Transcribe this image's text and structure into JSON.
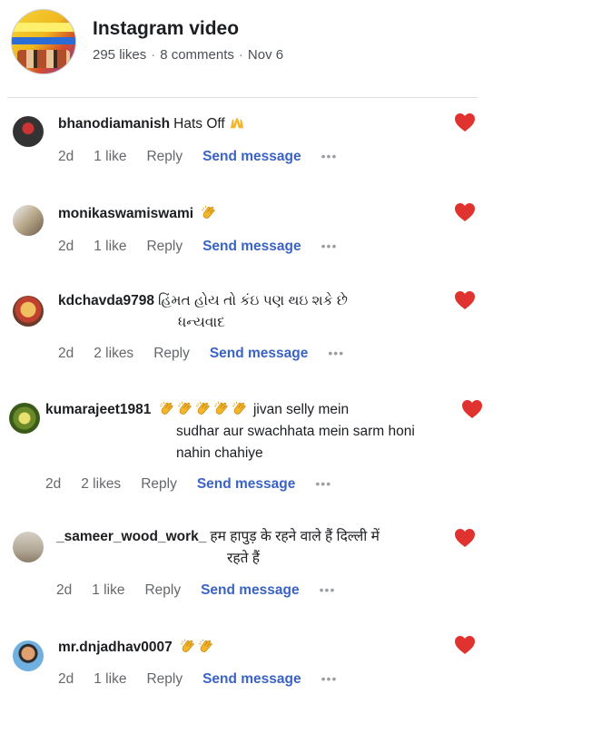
{
  "header": {
    "title": "Instagram video",
    "likes": "295 likes",
    "comments": "8 comments",
    "date": "Nov 6"
  },
  "colors": {
    "heart": "#e0332f",
    "link": "#3b63c4",
    "muted": "#65676b"
  },
  "comments": [
    {
      "user": "bhanodiamanish",
      "text": "Hats Off",
      "emoji": "raised-hands",
      "age": "2d",
      "likes": "1 like",
      "reply": "Reply",
      "send": "Send message",
      "more": "•••"
    },
    {
      "user": "monikaswamiswami",
      "text": "",
      "emoji": "clap",
      "age": "2d",
      "likes": "1 like",
      "reply": "Reply",
      "send": "Send message",
      "more": "•••"
    },
    {
      "user": "kdchavda9798",
      "text": "હિંમત હોય તો કંઇ પણ થઇ શકે છે",
      "text2": "ધન્યવાદ",
      "age": "2d",
      "likes": "2 likes",
      "reply": "Reply",
      "send": "Send message",
      "more": "•••"
    },
    {
      "user": "kumarajeet1981",
      "text": "jivan selly mein",
      "text2": "sudhar aur swachhata mein sarm honi",
      "text3": "nahin chahiye",
      "emoji": "clap x5",
      "age": "2d",
      "likes": "2 likes",
      "reply": "Reply",
      "send": "Send message",
      "more": "•••"
    },
    {
      "user": "_sameer_wood_work_",
      "text": "हम हापुड़ के रहने वाले हैं दिल्ली में",
      "text2": "रहते हैं",
      "age": "2d",
      "likes": "1 like",
      "reply": "Reply",
      "send": "Send message",
      "more": "•••"
    },
    {
      "user": "mr.dnjadhav0007",
      "text": "",
      "emoji": "clap x2",
      "age": "2d",
      "likes": "1 like",
      "reply": "Reply",
      "send": "Send message",
      "more": "•••"
    }
  ]
}
